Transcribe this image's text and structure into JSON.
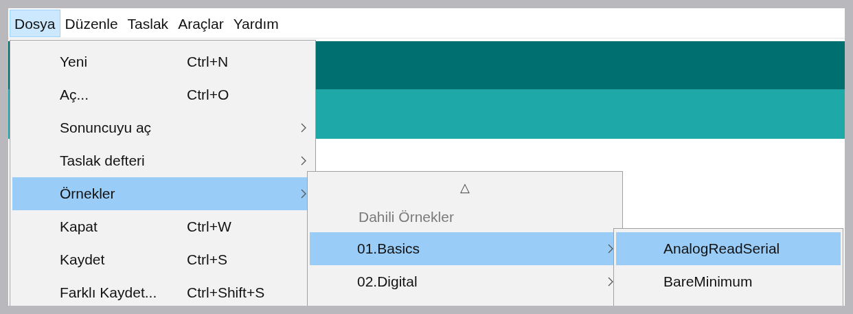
{
  "menubar": [
    {
      "label": "Dosya",
      "selected": true
    },
    {
      "label": "Düzenle",
      "selected": false
    },
    {
      "label": "Taslak",
      "selected": false
    },
    {
      "label": "Araçlar",
      "selected": false
    },
    {
      "label": "Yardım",
      "selected": false
    }
  ],
  "file_menu": {
    "items": [
      {
        "label": "Yeni",
        "shortcut": "Ctrl+N",
        "submenu": false,
        "selected": false
      },
      {
        "label": "Aç...",
        "shortcut": "Ctrl+O",
        "submenu": false,
        "selected": false
      },
      {
        "label": "Sonuncuyu aç",
        "submenu": true,
        "selected": false
      },
      {
        "label": "Taslak defteri",
        "submenu": true,
        "selected": false
      },
      {
        "label": "Örnekler",
        "submenu": true,
        "selected": true
      },
      {
        "label": "Kapat",
        "shortcut": "Ctrl+W",
        "submenu": false,
        "selected": false
      },
      {
        "label": "Kaydet",
        "shortcut": "Ctrl+S",
        "submenu": false,
        "selected": false
      },
      {
        "label": "Farklı Kaydet...",
        "shortcut": "Ctrl+Shift+S",
        "submenu": false,
        "selected": false
      }
    ]
  },
  "examples_menu": {
    "scroll_up": "△",
    "header": "Dahili Örnekler",
    "items": [
      {
        "label": "01.Basics",
        "submenu": true,
        "selected": true
      },
      {
        "label": "02.Digital",
        "submenu": true,
        "selected": false
      }
    ]
  },
  "basics_menu": {
    "items": [
      {
        "label": "AnalogReadSerial",
        "selected": true
      },
      {
        "label": "BareMinimum",
        "selected": false
      }
    ]
  }
}
